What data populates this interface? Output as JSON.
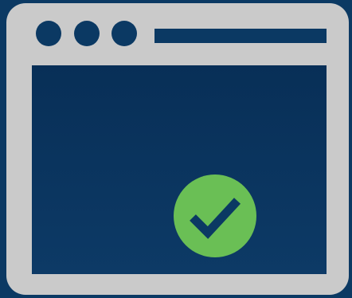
{
  "window": {
    "frame_icon": "browser-window-icon",
    "title_dots": [
      "window-dot-icon",
      "window-dot-icon",
      "window-dot-icon"
    ],
    "address_bar_icon": "address-bar-line"
  },
  "status": {
    "icon": "check-circle-icon",
    "state": "success"
  },
  "colors": {
    "background": "#0b3963",
    "frame": "#cacaca",
    "check": "#6abf55"
  }
}
